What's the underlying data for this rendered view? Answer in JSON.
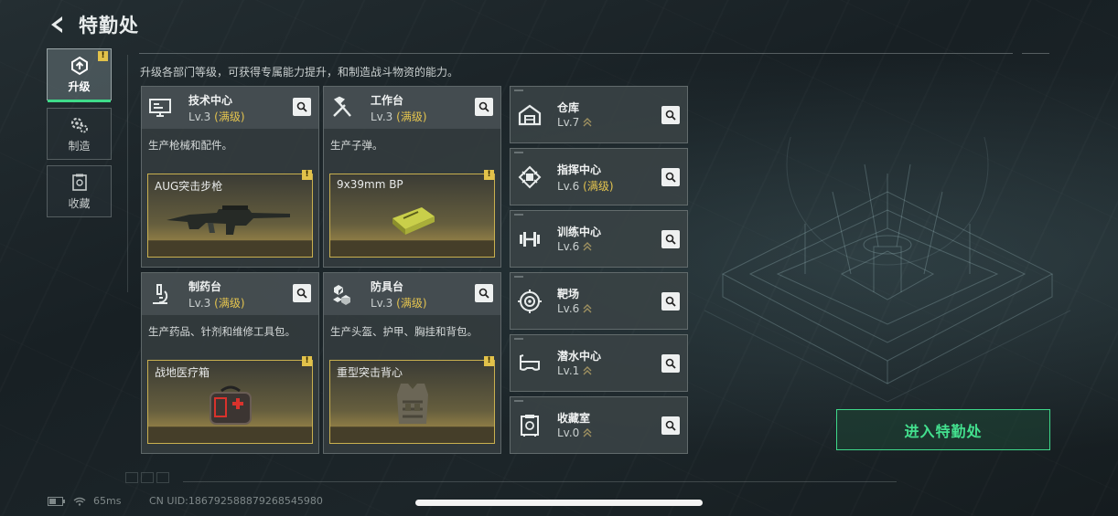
{
  "header": {
    "title": "特勤处"
  },
  "description": "升级各部门等级，可获得专属能力提升，和制造战斗物资的能力。",
  "side_tabs": [
    {
      "label": "升级",
      "active": true,
      "icon": "upgrade-icon"
    },
    {
      "label": "制造",
      "active": false,
      "icon": "gears-icon"
    },
    {
      "label": "收藏",
      "active": false,
      "icon": "collection-icon"
    }
  ],
  "workshops": [
    {
      "name": "技术中心",
      "level": "Lv.3",
      "max_label": "(满级)",
      "desc": "生产枪械和配件。",
      "product": "AUG突击步枪",
      "icon": "monitor-icon"
    },
    {
      "name": "工作台",
      "level": "Lv.3",
      "max_label": "(满级)",
      "desc": "生产子弹。",
      "product": "9x39mm BP",
      "icon": "tools-icon"
    },
    {
      "name": "制药台",
      "level": "Lv.3",
      "max_label": "(满级)",
      "desc": "生产药品、针剂和维修工具包。",
      "product": "战地医疗箱",
      "icon": "microscope-icon"
    },
    {
      "name": "防具台",
      "level": "Lv.3",
      "max_label": "(满级)",
      "desc": "生产头盔、护甲、胸挂和背包。",
      "product": "重型突击背心",
      "icon": "armor-boxes-icon"
    }
  ],
  "buildings": [
    {
      "name": "仓库",
      "level": "Lv.7",
      "max_label": "",
      "upgradable": true,
      "icon": "warehouse-icon"
    },
    {
      "name": "指挥中心",
      "level": "Lv.6",
      "max_label": "(满级)",
      "upgradable": false,
      "icon": "chip-icon"
    },
    {
      "name": "训练中心",
      "level": "Lv.6",
      "max_label": "",
      "upgradable": true,
      "icon": "dumbbell-icon"
    },
    {
      "name": "靶场",
      "level": "Lv.6",
      "max_label": "",
      "upgradable": true,
      "icon": "target-icon"
    },
    {
      "name": "潜水中心",
      "level": "Lv.1",
      "max_label": "",
      "upgradable": true,
      "icon": "diving-mask-icon"
    },
    {
      "name": "收藏室",
      "level": "Lv.0",
      "max_label": "",
      "upgradable": true,
      "icon": "safe-icon"
    }
  ],
  "enter_button": "进入特勤处",
  "status": {
    "ping": "65ms",
    "uid": "CN UID:186792588879268545980"
  },
  "colors": {
    "accent": "#3fdc8a",
    "max_level": "#e4c44f",
    "notice": "#e2c24a"
  }
}
